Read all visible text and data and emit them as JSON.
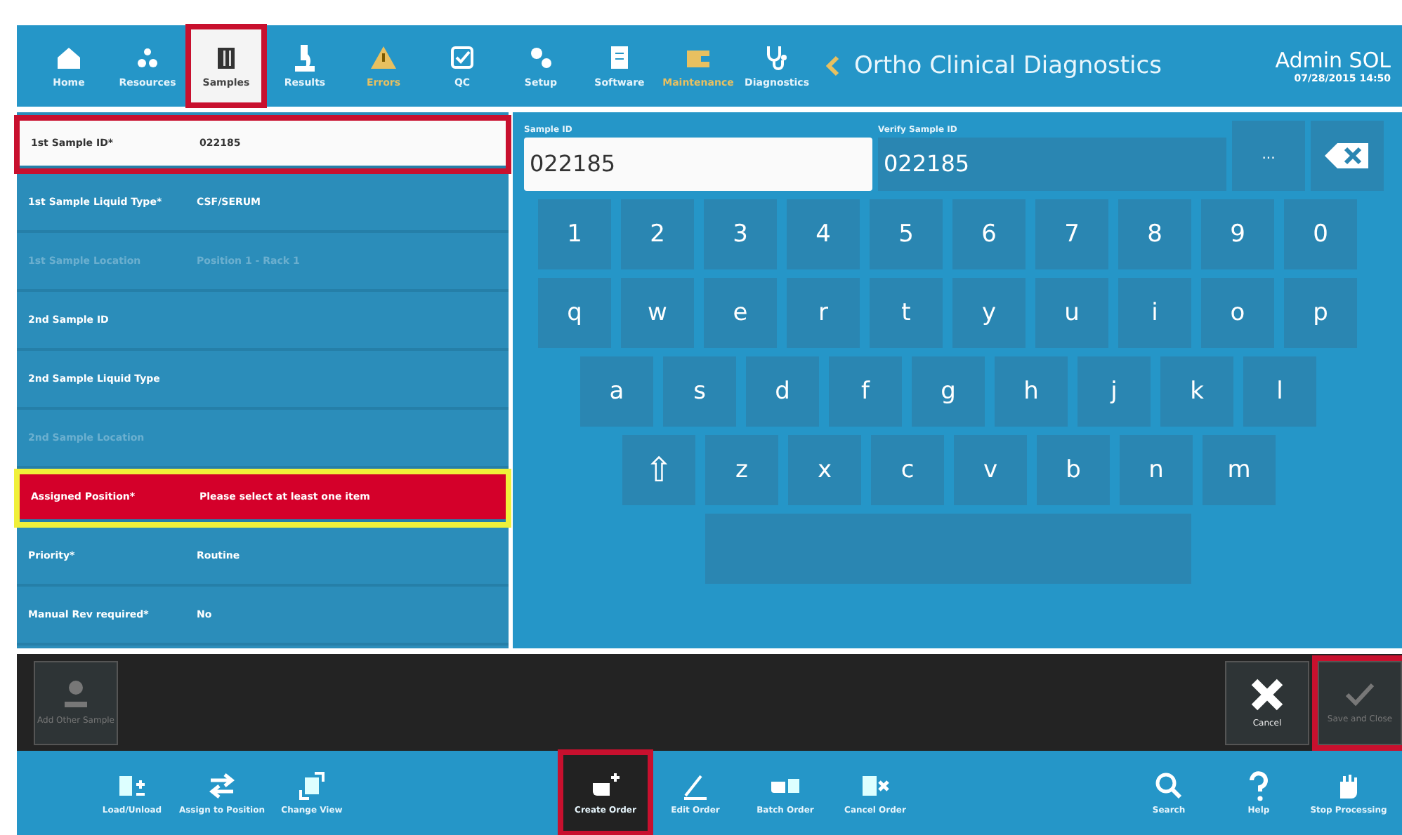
{
  "nav": {
    "items": [
      {
        "label": "Home",
        "selected": false,
        "warning": false,
        "annotated": false
      },
      {
        "label": "Resources",
        "selected": false,
        "warning": false,
        "annotated": false
      },
      {
        "label": "Samples",
        "selected": true,
        "warning": false,
        "annotated": true
      },
      {
        "label": "Results",
        "selected": false,
        "warning": false,
        "annotated": false
      },
      {
        "label": "Errors",
        "selected": false,
        "warning": true,
        "annotated": false
      },
      {
        "label": "QC",
        "selected": false,
        "warning": false,
        "annotated": false
      },
      {
        "label": "Setup",
        "selected": false,
        "warning": false,
        "annotated": false
      },
      {
        "label": "Software",
        "selected": false,
        "warning": false,
        "annotated": false
      },
      {
        "label": "Maintenance",
        "selected": false,
        "warning": true,
        "annotated": false
      },
      {
        "label": "Diagnostics",
        "selected": false,
        "warning": false,
        "annotated": false
      }
    ],
    "title": "Ortho Clinical Diagnostics",
    "user": "Admin SOL",
    "datetime": "07/28/2015 14:50"
  },
  "form": {
    "rows": [
      {
        "label": "1st Sample ID*",
        "value": "022185",
        "kind": "focused",
        "disabled": false,
        "color": "#c8102e"
      },
      {
        "label": "1st Sample Liquid Type*",
        "value": "CSF/SERUM",
        "kind": "normal",
        "disabled": false
      },
      {
        "label": "1st Sample Location",
        "value": "Position 1 - Rack 1",
        "kind": "normal",
        "disabled": true
      },
      {
        "label": "2nd Sample ID",
        "kind": "normal",
        "disabled": false
      },
      {
        "label": "2nd Sample Liquid Type",
        "kind": "normal",
        "disabled": false
      },
      {
        "label": "2nd Sample Location",
        "kind": "normal",
        "disabled": true
      },
      {
        "label": "Assigned Position*",
        "value": "Please select at least one item",
        "kind": "error",
        "disabled": false,
        "color": "#f0f03a"
      },
      {
        "label": "Priority*",
        "value": "Routine",
        "kind": "normal",
        "disabled": false
      },
      {
        "label": "Manual Rev required*",
        "value": "No",
        "kind": "normal",
        "disabled": false
      }
    ]
  },
  "entry": {
    "sample_id_label": "Sample ID",
    "sample_id": "022185",
    "verify_label": "Verify Sample ID",
    "verify_id": "022185",
    "more": "..."
  },
  "keyboard": {
    "rows": [
      {
        "keys": [
          "1",
          "2",
          "3",
          "4",
          "5",
          "6",
          "7",
          "8",
          "9",
          "0"
        ]
      },
      {
        "keys": [
          "q",
          "w",
          "e",
          "r",
          "t",
          "y",
          "u",
          "i",
          "o",
          "p"
        ]
      },
      {
        "keys": [
          "a",
          "s",
          "d",
          "f",
          "g",
          "h",
          "j",
          "k",
          "l"
        ]
      },
      {
        "shift": "⇧",
        "keys": [
          "z",
          "x",
          "c",
          "v",
          "b",
          "n",
          "m"
        ]
      }
    ]
  },
  "action_bar": {
    "add_label": "Add Other Sample",
    "cancel_label": "Cancel",
    "save_label": "Save and Close",
    "save_disabled": true
  },
  "toolbar": {
    "left": [
      {
        "label": "Load/Unload",
        "active": false
      },
      {
        "label": "Assign to Position",
        "active": false
      },
      {
        "label": "Change View",
        "active": false
      }
    ],
    "center": [
      {
        "label": "Create Order",
        "active": true
      },
      {
        "label": "Edit Order",
        "active": false
      },
      {
        "label": "Batch Order",
        "active": false
      },
      {
        "label": "Cancel Order",
        "active": false
      }
    ],
    "right": [
      {
        "label": "Search",
        "active": false
      },
      {
        "label": "Help",
        "active": false
      },
      {
        "label": "Stop Processing",
        "active": false
      }
    ]
  }
}
